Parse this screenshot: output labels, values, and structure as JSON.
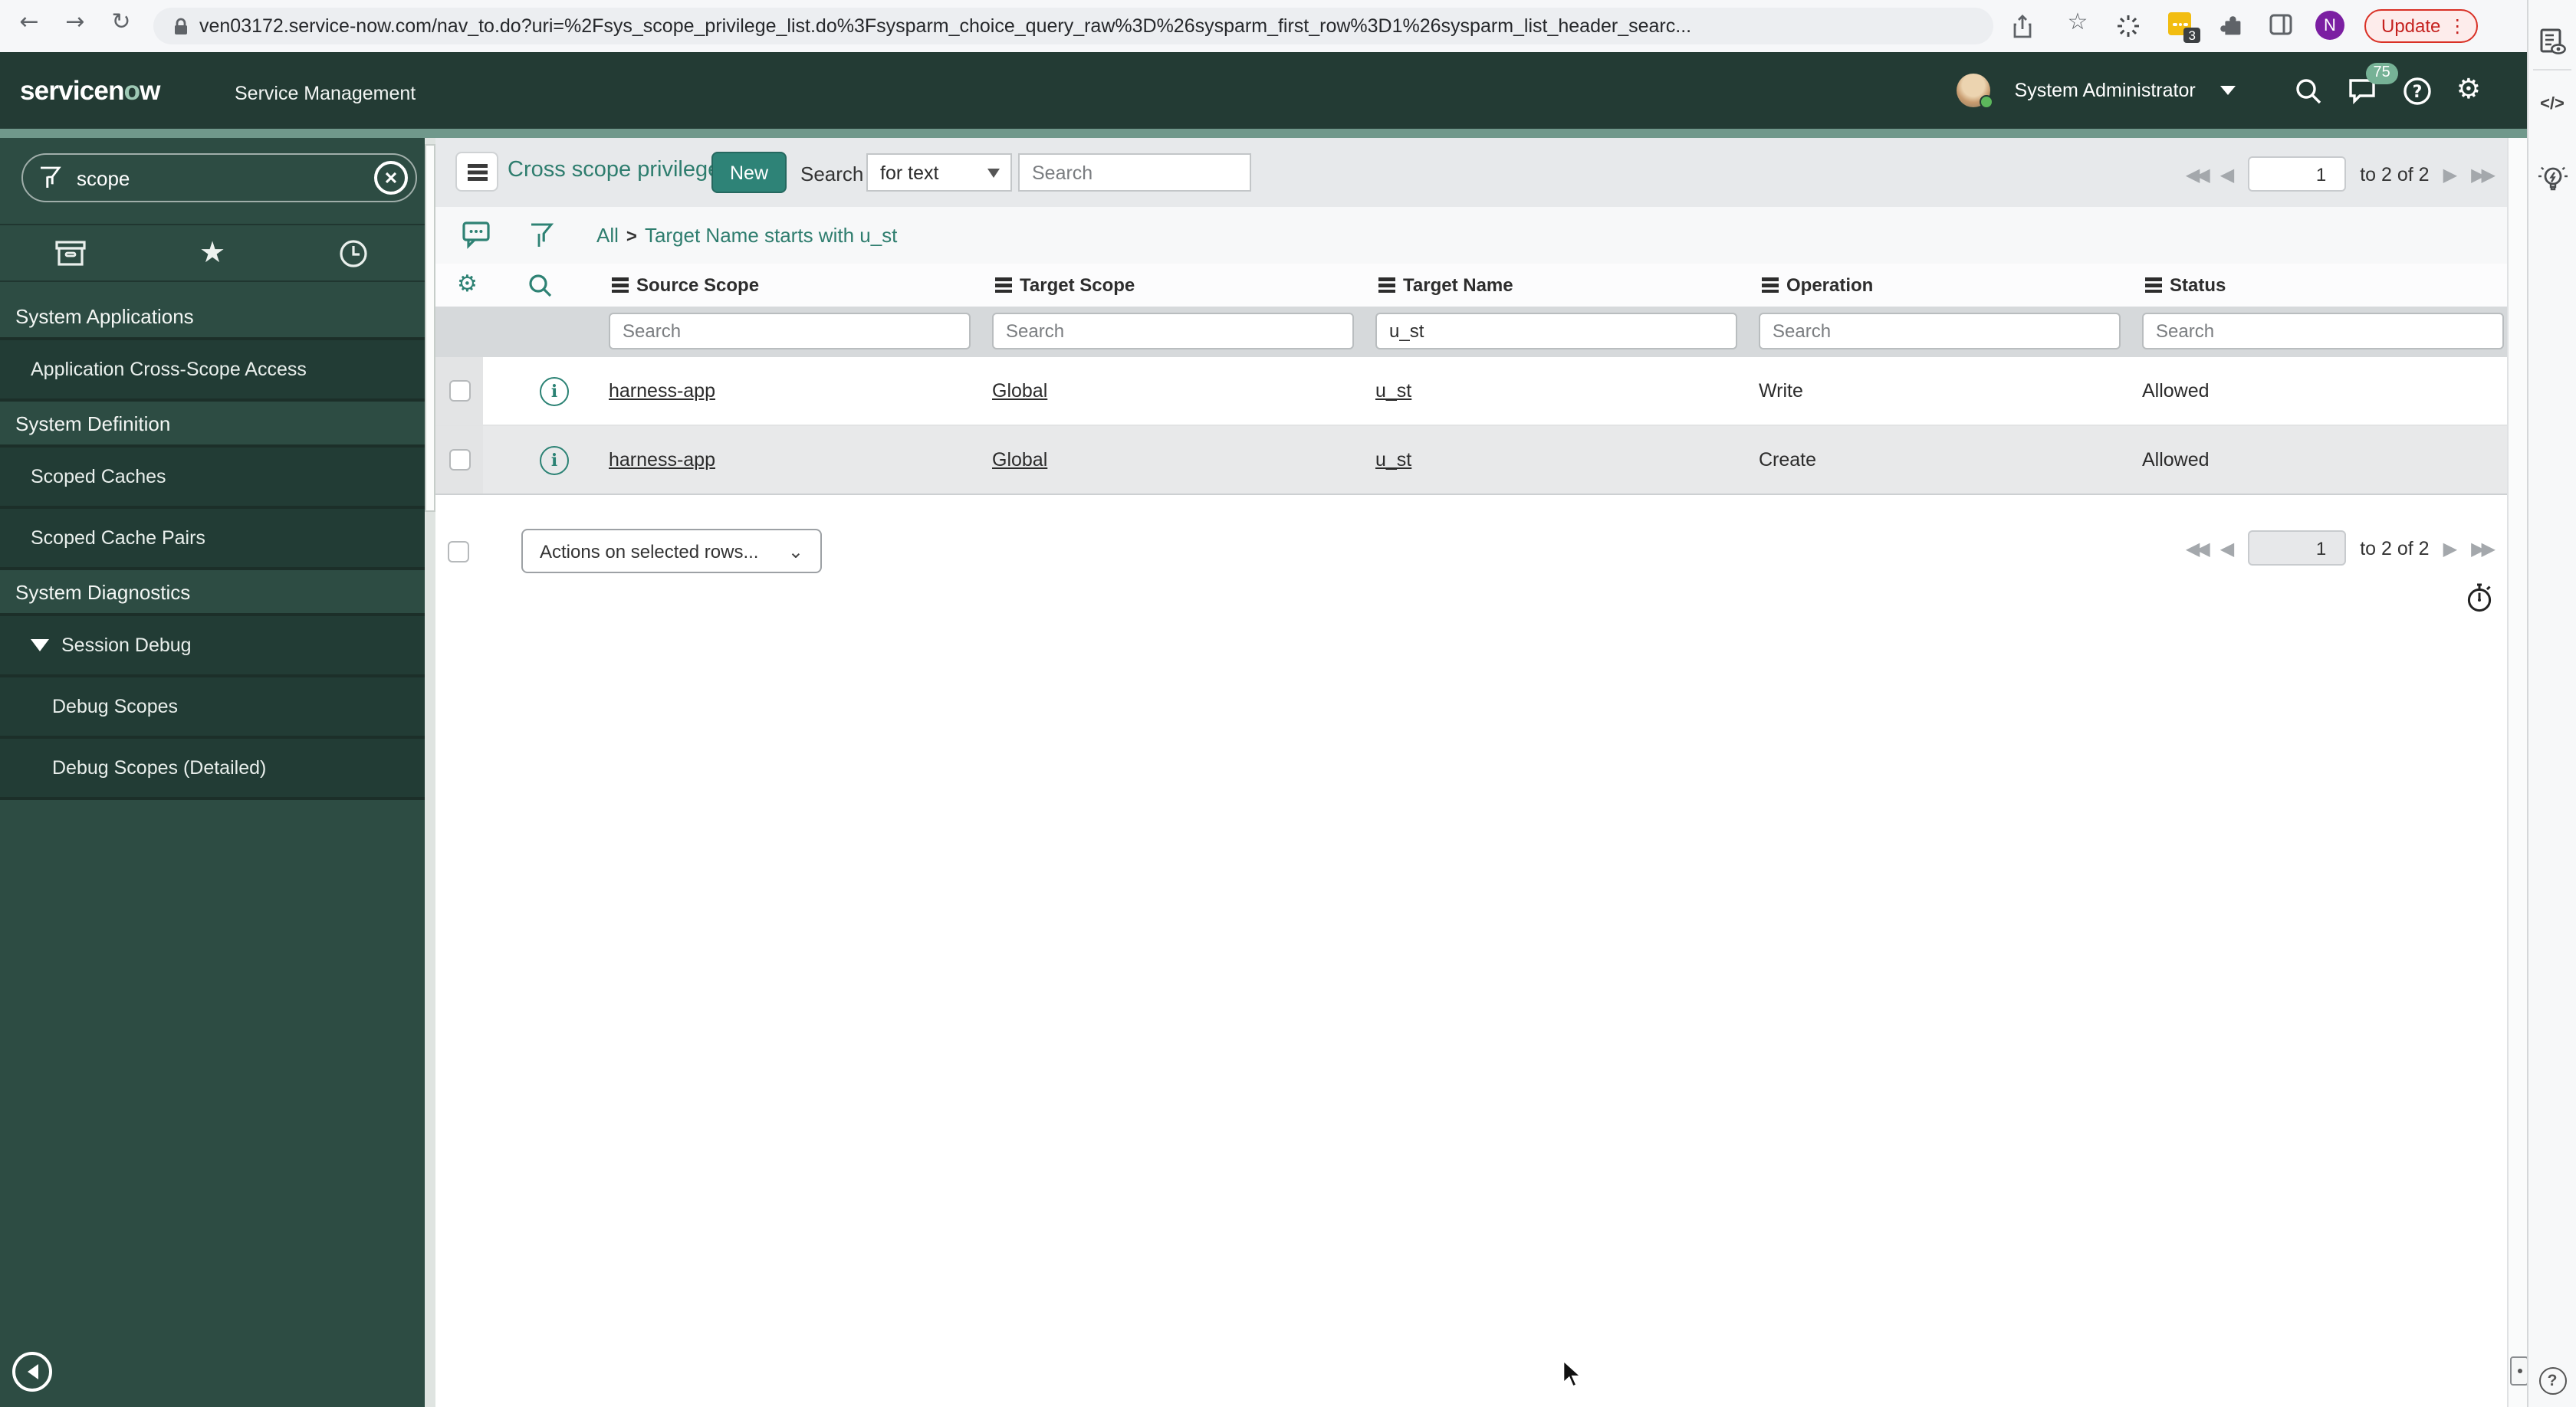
{
  "browser": {
    "url": "ven03172.service-now.com/nav_to.do?uri=%2Fsys_scope_privilege_list.do%3Fsysparm_choice_query_raw%3D%26sysparm_first_row%3D1%26sysparm_list_header_searc...",
    "update_label": "Update",
    "extension_badge": "3",
    "avatar_initial": "N"
  },
  "banner": {
    "logo_pre": "servicen",
    "logo_o": "o",
    "logo_post": "w",
    "product": "Service Management",
    "user": "System Administrator",
    "notification_count": "75"
  },
  "sidebar": {
    "search_value": "scope",
    "items": [
      {
        "label": "System Applications",
        "type": "section"
      },
      {
        "label": "Application Cross-Scope Access",
        "type": "item"
      },
      {
        "label": "System Definition",
        "type": "section"
      },
      {
        "label": "Scoped Caches",
        "type": "item"
      },
      {
        "label": "Scoped Cache Pairs",
        "type": "item"
      },
      {
        "label": "System Diagnostics",
        "type": "section"
      },
      {
        "label": "Session Debug",
        "type": "item-expanded"
      },
      {
        "label": "Debug Scopes",
        "type": "subitem"
      },
      {
        "label": "Debug Scopes (Detailed)",
        "type": "subitem"
      }
    ]
  },
  "list": {
    "title": "Cross scope privileges",
    "new_button": "New",
    "search_label": "Search",
    "search_type": "for text",
    "search_placeholder": "Search",
    "breadcrumb": {
      "root": "All",
      "separator": ">",
      "filter": "Target Name starts with u_st"
    },
    "columns": [
      "Source Scope",
      "Target Scope",
      "Target Name",
      "Operation",
      "Status"
    ],
    "filters": {
      "target_name": "u_st"
    },
    "rows": [
      {
        "source_scope": "harness-app",
        "target_scope": "Global",
        "target_name": "u_st",
        "operation": "Write",
        "status": "Allowed"
      },
      {
        "source_scope": "harness-app",
        "target_scope": "Global",
        "target_name": "u_st",
        "operation": "Create",
        "status": "Allowed"
      }
    ],
    "actions_label": "Actions on selected rows...",
    "pagination": {
      "page": "1",
      "range": "to 2 of 2"
    }
  },
  "colors": {
    "banner_green": "#233b34",
    "accent_teal": "#2e7d6e",
    "stripe_green": "#70988b",
    "new_button_green": "#2e8377"
  }
}
